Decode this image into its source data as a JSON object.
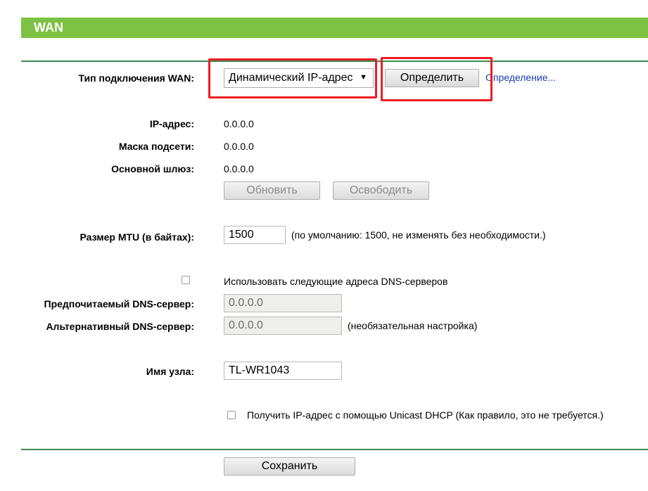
{
  "header": {
    "title": "WAN"
  },
  "connection": {
    "label": "Тип подключения WAN:",
    "selected": "Динамический IP-адрес",
    "detect_button": "Определить",
    "detect_link": "Определение..."
  },
  "status": {
    "ip_label": "IP-адрес:",
    "ip_value": "0.0.0.0",
    "mask_label": "Маска подсети:",
    "mask_value": "0.0.0.0",
    "gateway_label": "Основной шлюз:",
    "gateway_value": "0.0.0.0",
    "renew_button": "Обновить",
    "release_button": "Освободить"
  },
  "mtu": {
    "label": "Размер MTU (в байтах):",
    "value": "1500",
    "note": "(по умолчанию: 1500, не изменять без необходимости.)"
  },
  "dns": {
    "use_label": "Использовать следующие адреса DNS-серверов",
    "primary_label": "Предпочитаемый DNS-сервер:",
    "primary_value": "0.0.0.0",
    "secondary_label": "Альтернативный DNS-сервер:",
    "secondary_value": "0.0.0.0",
    "secondary_note": "(необязательная настройка)"
  },
  "host": {
    "label": "Имя узла:",
    "value": "TL-WR1043"
  },
  "unicast": {
    "label": "Получить IP-адрес с помощью Unicast DHCP (Как правило, это не требуется.)"
  },
  "save_button": "Сохранить",
  "colors": {
    "header": "#7dc243",
    "divider": "#3d8a52",
    "highlight": "#ee1d23",
    "link": "#1a3ab4"
  }
}
